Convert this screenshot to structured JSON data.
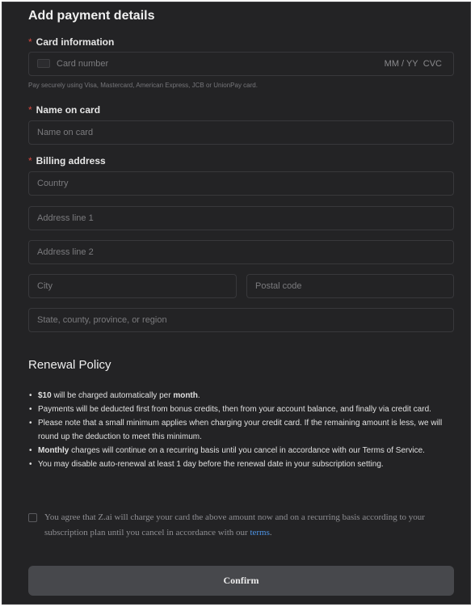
{
  "form": {
    "title": "Add payment details",
    "card_information_label": "Card information",
    "card_number_placeholder": "Card number",
    "expiry_placeholder": "MM / YY",
    "cvc_placeholder": "CVC",
    "card_hint": "Pay securely using Visa, Mastercard, American Express, JCB or UnionPay card.",
    "name_label": "Name on card",
    "name_placeholder": "Name on card",
    "billing_label": "Billing address",
    "country_placeholder": "Country",
    "address1_placeholder": "Address line 1",
    "address2_placeholder": "Address line 2",
    "city_placeholder": "City",
    "postal_placeholder": "Postal code",
    "state_placeholder": "State, county, province, or region",
    "required_marker": "*"
  },
  "renewal": {
    "title": "Renewal Policy",
    "item1_amount": "$10",
    "item1_text": " will be charged automatically per ",
    "item1_period": "month",
    "item1_end": ".",
    "item2": "Payments will be deducted first from bonus credits, then from your account balance, and finally via credit card.",
    "item3": "Please note that a small minimum applies when charging your credit card. If the remaining amount is less, we will round up the deduction to meet this minimum.",
    "item4_bold": "Monthly",
    "item4_text": " charges will continue on a recurring basis until you cancel in accordance with our Terms of Service.",
    "item5": "You may disable auto-renewal at least 1 day before the renewal date in your subscription setting."
  },
  "agreement": {
    "text": "You agree that Z.ai will charge your card the above amount now and on a recurring basis according to your subscription plan until you cancel in accordance with our ",
    "link": "terms",
    "end": ".",
    "checked": false
  },
  "actions": {
    "confirm_label": "Confirm"
  },
  "colors": {
    "background": "#232325",
    "required": "#d9483f",
    "link": "#4d94e6",
    "button": "#47484c"
  }
}
